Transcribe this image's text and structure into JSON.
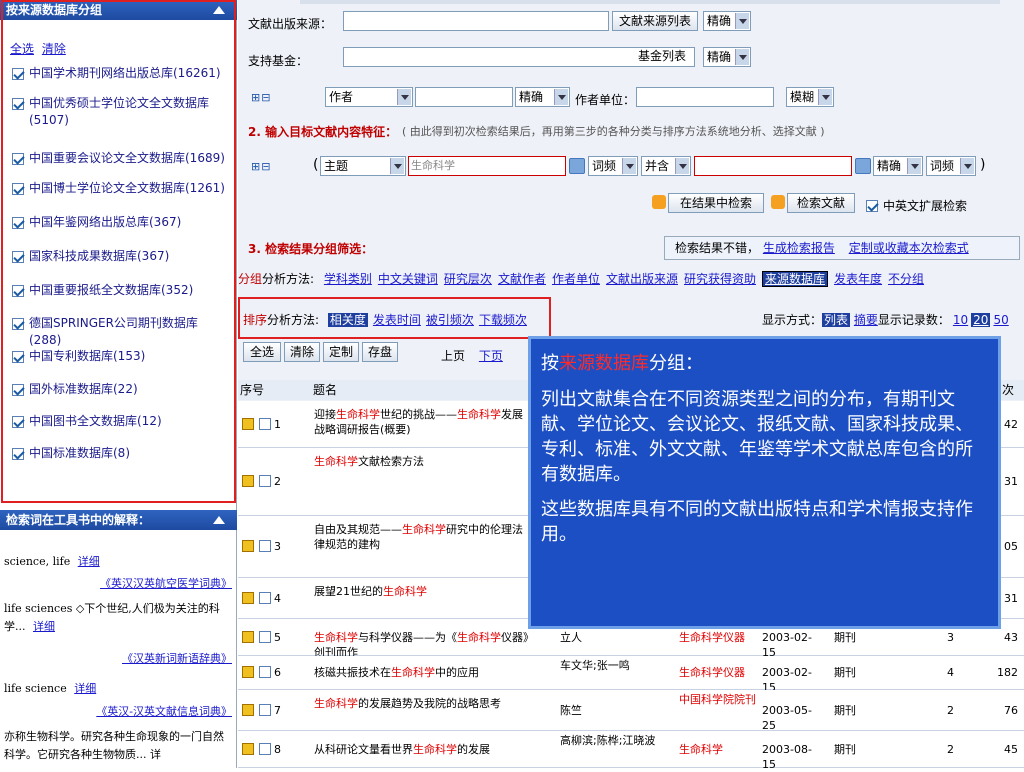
{
  "left": {
    "db_panel_title": "按来源数据库分组",
    "select_all": "全选",
    "clear": "清除",
    "databases": [
      {
        "name": "中国学术期刊网络出版总库(16261)"
      },
      {
        "name": "中国优秀硕士学位论文全文数据库(5107)"
      },
      {
        "name": "中国重要会议论文全文数据库(1689)"
      },
      {
        "name": "中国博士学位论文全文数据库(1261)"
      },
      {
        "name": "中国年鉴网络出版总库(367)"
      },
      {
        "name": "国家科技成果数据库(367)"
      },
      {
        "name": "中国重要报纸全文数据库(352)"
      },
      {
        "name": "德国SPRINGER公司期刊数据库(288)"
      },
      {
        "name": "中国专利数据库(153)"
      },
      {
        "name": "国外标准数据库(22)"
      },
      {
        "name": "中国图书全文数据库(12)"
      },
      {
        "name": "中国标准数据库(8)"
      }
    ],
    "dict_panel_title": "检索词在工具书中的解释：",
    "dict": [
      {
        "term": "science, life",
        "more": "详细",
        "source": "《英汉汉英航空医学词典》"
      },
      {
        "term": "life sciences ◇下个世纪,人们极为关注的科学...",
        "more": "详细",
        "source": "《汉英新词新语辞典》"
      },
      {
        "term": "life science",
        "more": "详细",
        "source": "《英汉-汉英文献信息词典》"
      },
      {
        "term": "亦称生物科学。研究各种生命现象的一门自然科学。它研究各种生物物质... 详",
        "more": "",
        "source": ""
      }
    ]
  },
  "form": {
    "source_label": "文献出版来源：",
    "source_list_btn": "文献来源列表",
    "fund_label": "支持基金：",
    "fund_list_btn": "基金列表",
    "exact": "精确",
    "author_select": "作者",
    "author_exact": "精确",
    "org_label": "作者单位：",
    "fuzzy": "模糊",
    "step2": "2. 输入目标文献内容特征：",
    "step2_note": "( 由此得到初次检索结果后，再用第三步的各种分类与排序方法系统地分析、选择文献 )",
    "paren_open": "(",
    "paren_close": ")",
    "field_select": "主题",
    "keyword_value": "生命科学",
    "freq1": "词频",
    "combine": "并含",
    "exact2": "精确",
    "freq2": "词频",
    "search_in_results": "在结果中检索",
    "search_btn": "检索文献",
    "cn_en_ext": "中英文扩展检索",
    "step3": "3. 检索结果分组筛选：",
    "result_hint": "检索结果不错，",
    "gen_report": "生成检索报告",
    "custom_save": "定制或收藏本次检索式"
  },
  "group": {
    "prefix_red": "分组",
    "prefix": "分析方法:",
    "items": [
      "学科类别",
      "中文关键词",
      "研究层次",
      "文献作者",
      "作者单位",
      "文献出版来源",
      "研究获得资助",
      "来源数据库",
      "发表年度",
      "不分组"
    ],
    "active_index": 7
  },
  "sort": {
    "prefix_red": "排序",
    "prefix": "分析方法:",
    "items": [
      "相关度",
      "发表时间",
      "被引频次",
      "下载频次"
    ],
    "active_index": 0,
    "display_label": "显示方式：",
    "list": "列表",
    "abstract": "摘要",
    "count_label": "显示记录数：",
    "counts": [
      "10",
      "20",
      "50"
    ],
    "active_count": "20"
  },
  "toolbar": {
    "select_all": "全选",
    "clear": "清除",
    "custom": "定制",
    "save": "存盘",
    "prev": "上页",
    "next": "下页"
  },
  "table": {
    "col_no": "序号",
    "col_title": "题名",
    "col_count_partial": "次",
    "rows": [
      {
        "no": "1",
        "title": "迎接生命科学世纪的挑战——生命科学发展战略调研报告(概要)",
        "author": "",
        "source": "",
        "date": "",
        "type": "",
        "cited": "",
        "downloads": "42"
      },
      {
        "no": "2",
        "title": "生命科学文献检索方法",
        "author": "",
        "source": "",
        "date": "",
        "type": "",
        "cited": "",
        "downloads": "31"
      },
      {
        "no": "3",
        "title": "自由及其规范——生命科学研究中的伦理法律规范的建构",
        "author": "",
        "source": "",
        "date": "",
        "type": "",
        "cited": "",
        "downloads": "05"
      },
      {
        "no": "4",
        "title": "展望21世纪的生命科学",
        "author": "",
        "source": "",
        "date": "",
        "type": "",
        "cited": "",
        "downloads": "31"
      },
      {
        "no": "5",
        "title": "生命科学与科学仪器——为《生命科学仪器》创刊而作",
        "author": "立人",
        "source": "生命科学仪器",
        "date": "2003-02-15",
        "type": "期刊",
        "cited": "3",
        "downloads": "43"
      },
      {
        "no": "6",
        "title": "核磁共振技术在生命科学中的应用",
        "author": "车文华;张一鸣",
        "source": "生命科学仪器",
        "date": "2003-02-15",
        "type": "期刊",
        "cited": "4",
        "downloads": "182"
      },
      {
        "no": "7",
        "title": "生命科学的发展趋势及我院的战略思考",
        "author": "陈竺",
        "source": "中国科学院院刊",
        "date": "2003-05-25",
        "type": "期刊",
        "cited": "2",
        "downloads": "76"
      },
      {
        "no": "8",
        "title": "从科研论文量看世界生命科学的发展",
        "author": "高柳滨;陈桦;江晓波",
        "source": "生命科学",
        "date": "2003-08-15",
        "type": "期刊",
        "cited": "2",
        "downloads": "45"
      }
    ]
  },
  "popup": {
    "title_pre": "按",
    "title_hl": "来源数据库",
    "title_post": "分组：",
    "p1": "列出文献集合在不同资源类型之间的分布，有期刊文献、学位论文、会议论文、报纸文献、国家科技成果、专利、标准、外文文献、年鉴等学术文献总库包含的所有数据库。",
    "p2": "这些数据库具有不同的文献出版特点和学术情报支持作用。"
  },
  "colors": {
    "accent_red": "#e02020",
    "popup_bg": "#1d4fc4",
    "highlight": "#c00000"
  }
}
